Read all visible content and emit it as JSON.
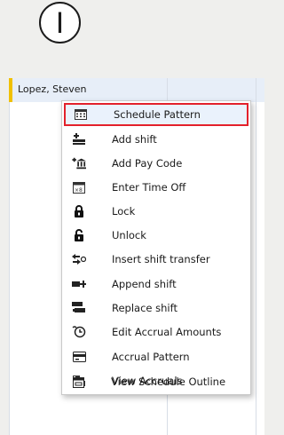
{
  "badge": {
    "label": "I"
  },
  "employee": {
    "name": "Lopez, Steven"
  },
  "context_menu": {
    "items": [
      {
        "label": "Schedule Pattern",
        "icon": "calendar-grid-icon",
        "selected": true
      },
      {
        "label": "Add shift",
        "icon": "add-shift-icon"
      },
      {
        "label": "Add Pay Code",
        "icon": "add-pay-code-icon"
      },
      {
        "label": "Enter Time Off",
        "icon": "time-off-icon"
      },
      {
        "label": "Lock",
        "icon": "lock-icon"
      },
      {
        "label": "Unlock",
        "icon": "unlock-icon"
      },
      {
        "label": "Insert shift transfer",
        "icon": "shift-transfer-icon"
      },
      {
        "label": "Append shift",
        "icon": "append-shift-icon"
      },
      {
        "label": "Replace shift",
        "icon": "replace-shift-icon"
      },
      {
        "label": "Edit Accrual Amounts",
        "icon": "edit-accrual-icon"
      },
      {
        "label": "Accrual Pattern",
        "icon": "accrual-pattern-icon"
      },
      {
        "label": "View Accruals",
        "icon": "view-accruals-icon"
      },
      {
        "label": "View Schedule Outline",
        "icon": "schedule-outline-icon"
      }
    ],
    "highlight_color": "#e3212b"
  }
}
